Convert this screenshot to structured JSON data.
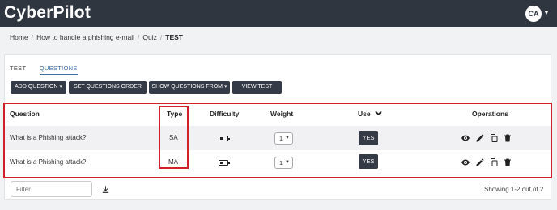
{
  "app": {
    "logo": "CyberPilot",
    "avatar_initials": "CA"
  },
  "breadcrumb": {
    "items": [
      "Home",
      "How to handle a phishing e-mail",
      "Quiz"
    ],
    "current": "TEST"
  },
  "tabs": [
    {
      "label": "TEST",
      "active": false
    },
    {
      "label": "QUESTIONS",
      "active": true
    }
  ],
  "toolbar": {
    "add_question": "ADD QUESTION",
    "set_order": "SET QUESTIONS ORDER",
    "show_from": "SHOW QUESTIONS FROM",
    "view_test": "VIEW TEST"
  },
  "table": {
    "headers": {
      "question": "Question",
      "type": "Type",
      "difficulty": "Difficulty",
      "weight": "Weight",
      "use": "Use",
      "operations": "Operations"
    },
    "rows": [
      {
        "question": "What is a Phishing attack?",
        "type": "SA",
        "weight": "1",
        "use": "YES"
      },
      {
        "question": "What is a Phishing attack?",
        "type": "MA",
        "weight": "1",
        "use": "YES"
      }
    ]
  },
  "filter": {
    "placeholder": "Filter"
  },
  "pagination": {
    "showing": "Showing 1-2 out of 2"
  },
  "colors": {
    "topbar": "#2f3640",
    "button": "#343a46",
    "highlight": "#d0202c",
    "active_tab": "#3a6ea5"
  },
  "icons": [
    "caret-down-icon",
    "battery-low-icon",
    "chevron-down-icon",
    "eye-icon",
    "pencil-icon",
    "copy-icon",
    "trash-icon",
    "download-icon"
  ]
}
